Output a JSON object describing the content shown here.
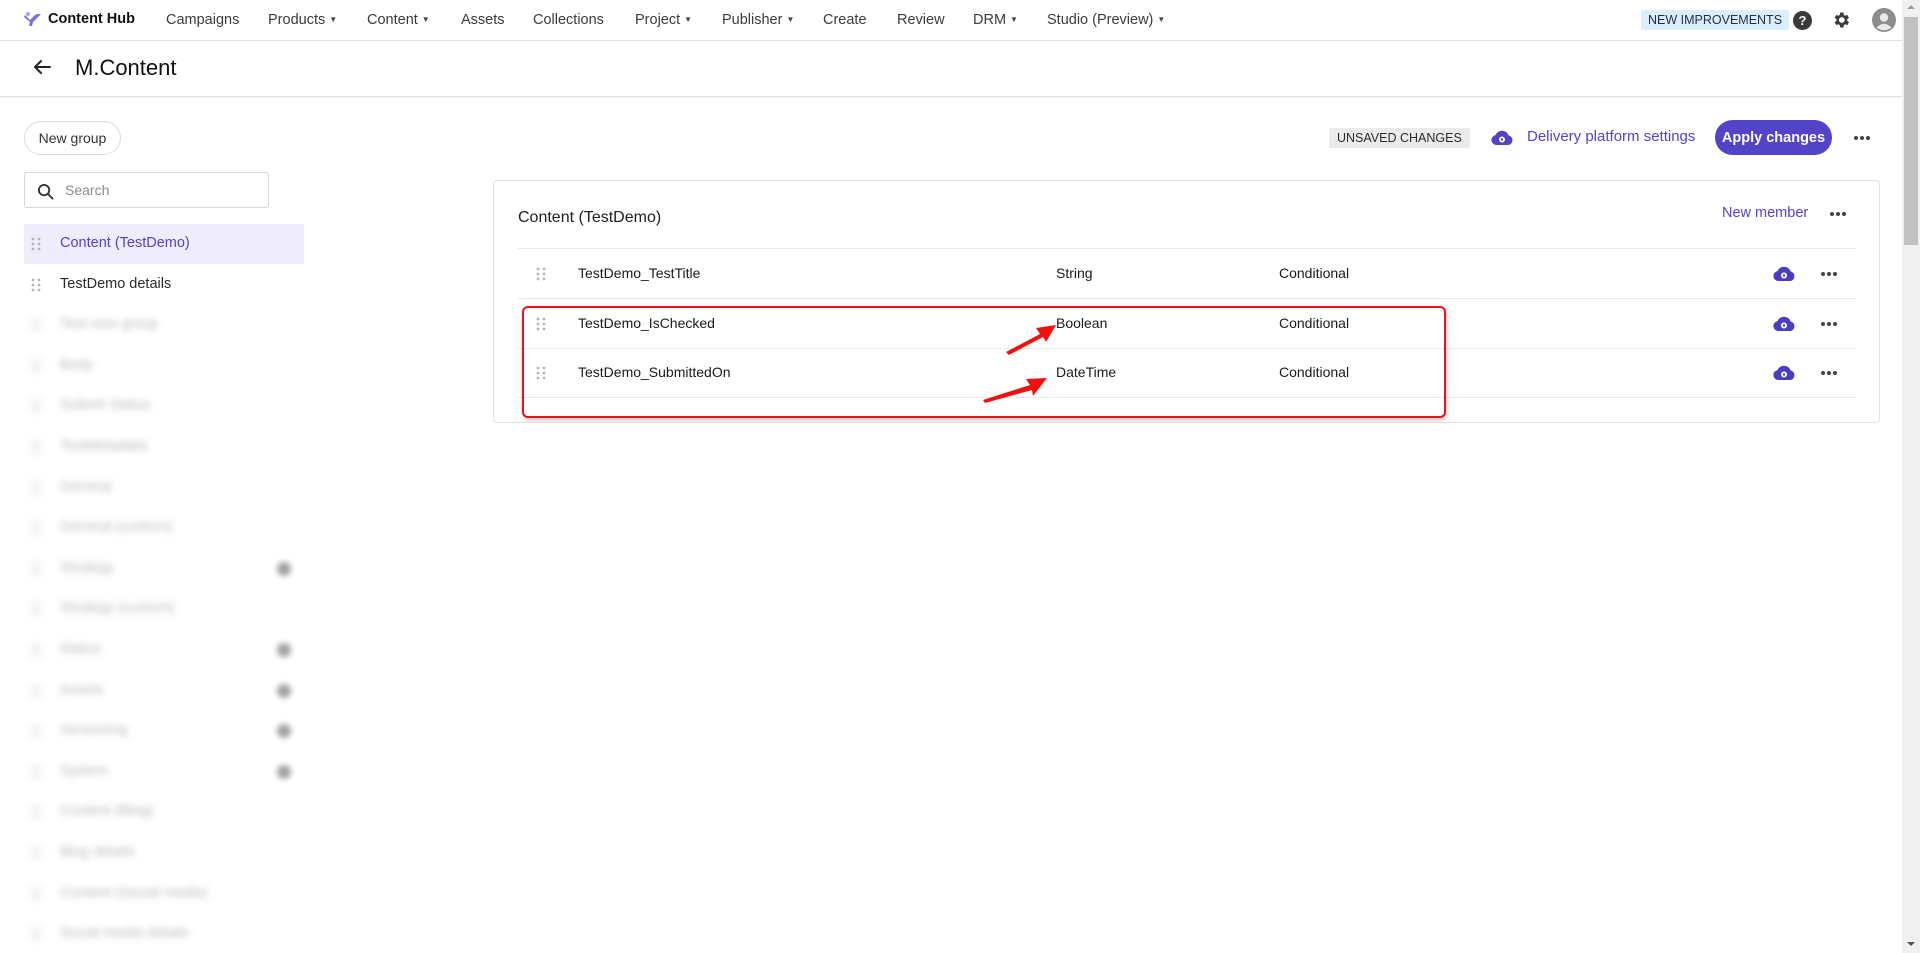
{
  "topnav": {
    "brand": "Content Hub",
    "items": [
      {
        "label": "Campaigns",
        "dropdown": false
      },
      {
        "label": "Products",
        "dropdown": true
      },
      {
        "label": "Content",
        "dropdown": true
      },
      {
        "label": "Assets",
        "dropdown": false
      },
      {
        "label": "Collections",
        "dropdown": false
      },
      {
        "label": "Project",
        "dropdown": true
      },
      {
        "label": "Publisher",
        "dropdown": true
      },
      {
        "label": "Create",
        "dropdown": false
      },
      {
        "label": "Review",
        "dropdown": false
      },
      {
        "label": "DRM",
        "dropdown": true
      },
      {
        "label": "Studio (Preview)",
        "dropdown": true
      }
    ],
    "new_improvements": "NEW IMPROVEMENTS",
    "help_glyph": "?",
    "icons": [
      "help-icon",
      "gear-icon",
      "user-avatar-icon"
    ]
  },
  "header": {
    "title": "M.Content",
    "back_icon": "arrow-left-icon"
  },
  "sidebar": {
    "new_group_label": "New group",
    "search_placeholder": "Search",
    "search_value": "",
    "items": [
      {
        "label": "Content (TestDemo)",
        "active": true,
        "blurred": false,
        "badge": false
      },
      {
        "label": "TestDemo details",
        "active": false,
        "blurred": false,
        "badge": false
      },
      {
        "label": "Test new group",
        "active": false,
        "blurred": true,
        "badge": false
      },
      {
        "label": "Body",
        "active": false,
        "blurred": true,
        "badge": false
      },
      {
        "label": "Submit Status",
        "active": false,
        "blurred": true,
        "badge": false
      },
      {
        "label": "TestMetadata",
        "active": false,
        "blurred": true,
        "badge": false
      },
      {
        "label": "General",
        "active": false,
        "blurred": true,
        "badge": false
      },
      {
        "label": "General (custom)",
        "active": false,
        "blurred": true,
        "badge": false
      },
      {
        "label": "Strategy",
        "active": false,
        "blurred": true,
        "badge": true
      },
      {
        "label": "Strategy (custom)",
        "active": false,
        "blurred": true,
        "badge": false
      },
      {
        "label": "Status",
        "active": false,
        "blurred": true,
        "badge": true
      },
      {
        "label": "Assets",
        "active": false,
        "blurred": true,
        "badge": true
      },
      {
        "label": "Versioning",
        "active": false,
        "blurred": true,
        "badge": true
      },
      {
        "label": "System",
        "active": false,
        "blurred": true,
        "badge": true
      },
      {
        "label": "Content (Blog)",
        "active": false,
        "blurred": true,
        "badge": false
      },
      {
        "label": "Blog details",
        "active": false,
        "blurred": true,
        "badge": false
      },
      {
        "label": "Content (Social media)",
        "active": false,
        "blurred": true,
        "badge": false
      },
      {
        "label": "Social media details",
        "active": false,
        "blurred": true,
        "badge": false
      }
    ]
  },
  "actions": {
    "unsaved_badge": "UNSAVED CHANGES",
    "delivery_link": "Delivery platform settings",
    "apply_label": "Apply changes",
    "more_icon": "more-horizontal-icon"
  },
  "group": {
    "title": "Content (TestDemo)",
    "new_member_label": "New member",
    "members": [
      {
        "name": "TestDemo_TestTitle",
        "type": "String",
        "condition": "Conditional",
        "highlighted": false
      },
      {
        "name": "TestDemo_IsChecked",
        "type": "Boolean",
        "condition": "Conditional",
        "highlighted": true
      },
      {
        "name": "TestDemo_SubmittedOn",
        "type": "DateTime",
        "condition": "Conditional",
        "highlighted": true
      }
    ]
  },
  "annotation": {
    "color": "#e8141c",
    "note": "red box highlighting IsChecked and SubmittedOn rows; arrows pointing at Boolean and DateTime types"
  },
  "colors": {
    "accent": "#5243c9",
    "active_bg": "#efedfb",
    "new_improvements_bg": "#dbeefd"
  }
}
